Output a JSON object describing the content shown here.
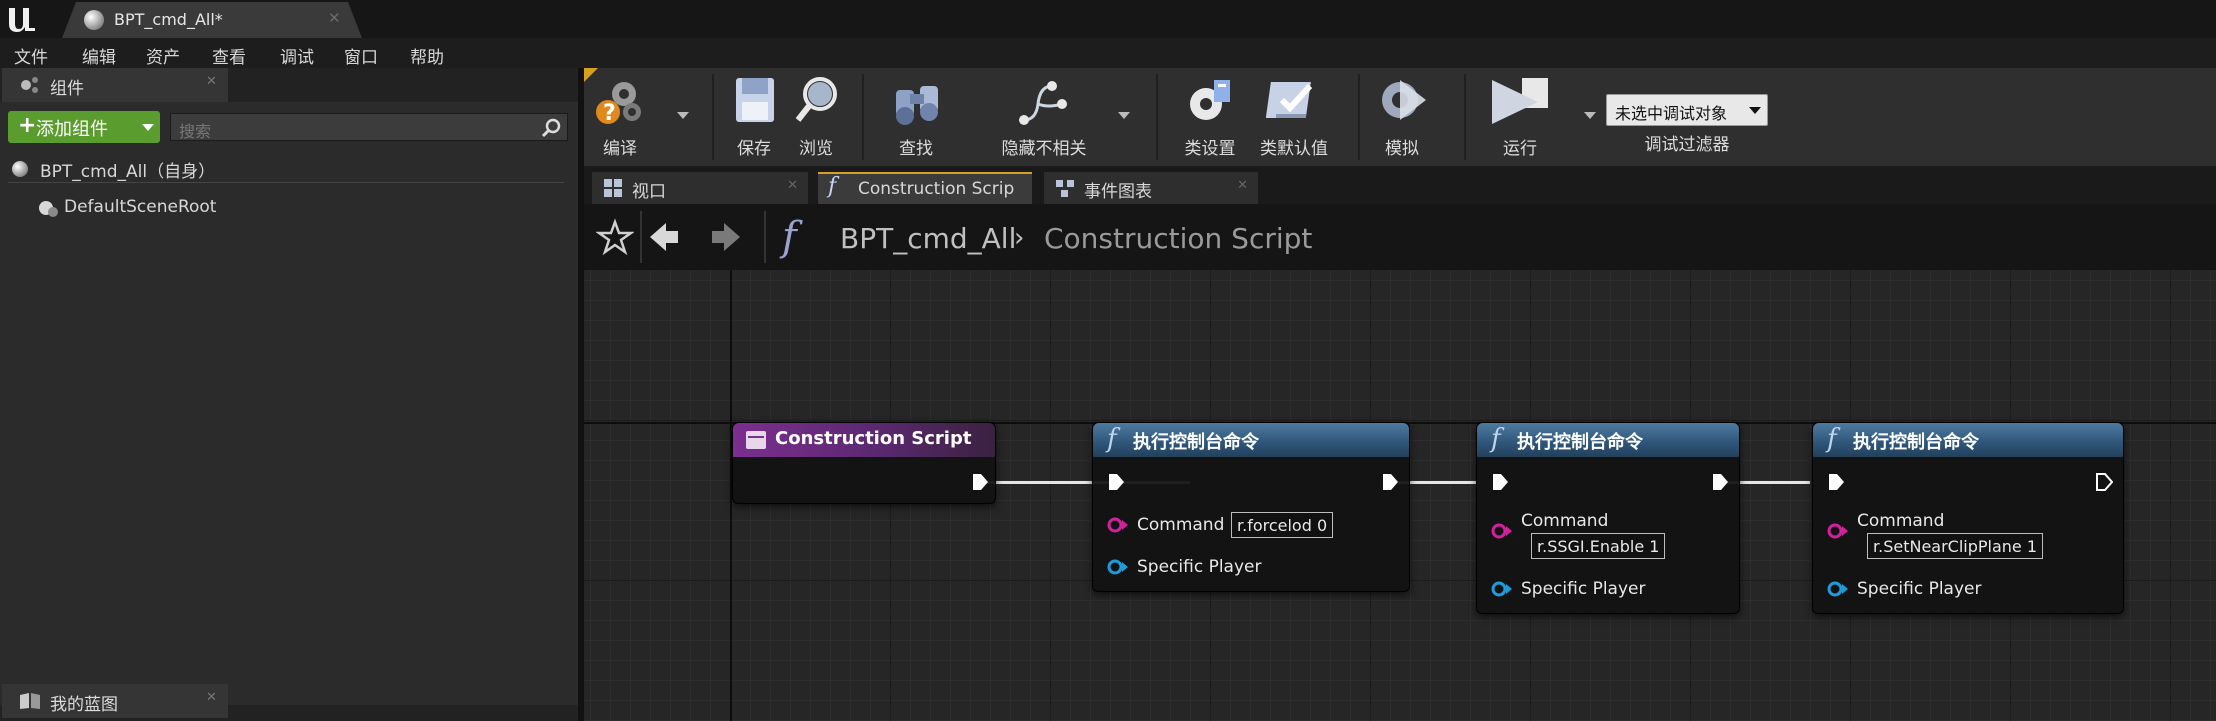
{
  "window": {
    "doc_tab": "BPT_cmd_All*"
  },
  "menu": [
    "文件",
    "编辑",
    "资产",
    "查看",
    "调试",
    "窗口",
    "帮助"
  ],
  "components_panel": {
    "tab_title": "组件",
    "add_button": "添加组件",
    "search_placeholder": "搜索",
    "self_item": "BPT_cmd_All（自身）",
    "root_item": "DefaultSceneRoot"
  },
  "my_blueprint_panel": {
    "tab_title": "我的蓝图"
  },
  "toolbar": {
    "compile": "编译",
    "save": "保存",
    "browse": "浏览",
    "find": "查找",
    "hide_unrelated": "隐藏不相关",
    "class_settings": "类设置",
    "class_defaults": "类默认值",
    "simulate": "模拟",
    "play": "运行",
    "debug_object": "未选中调试对象",
    "debug_filter": "调试过滤器"
  },
  "editor_tabs": [
    {
      "label": "视口",
      "icon": "viewport-icon",
      "active": false
    },
    {
      "label": "Construction Script",
      "icon": "function-icon",
      "active": true
    },
    {
      "label": "事件图表",
      "icon": "event-graph-icon",
      "active": false
    }
  ],
  "breadcrumb": {
    "blueprint": "BPT_cmd_All",
    "graph": "Construction Script"
  },
  "graph": {
    "entry_node": {
      "title": "Construction Script"
    },
    "nodes": [
      {
        "title": "执行控制台命令",
        "command_label": "Command",
        "command_value": "r.forcelod 0",
        "player_label": "Specific Player"
      },
      {
        "title": "执行控制台命令",
        "command_label": "Command",
        "command_value": "r.SSGI.Enable 1",
        "player_label": "Specific Player"
      },
      {
        "title": "执行控制台命令",
        "command_label": "Command",
        "command_value": "r.SetNearClipPlane 1",
        "player_label": "Specific Player"
      }
    ]
  },
  "colors": {
    "entry_header": "#7b2f8f",
    "function_header": "#2e5578",
    "string_pin": "#d0229a",
    "object_pin": "#1f9bd8",
    "add_button": "#5a9c2e",
    "active_tab_accent": "#d8a020"
  }
}
